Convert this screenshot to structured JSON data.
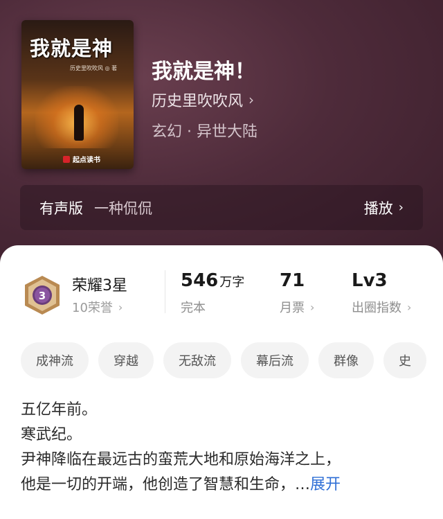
{
  "cover": {
    "title": "我就是神",
    "author": "历史里吹吹风 ◎ 著",
    "publisher": "起点读书"
  },
  "book": {
    "title": "我就是神！",
    "author": "历史里吹吹风",
    "genre": "玄幻 · 异世大陆"
  },
  "audio": {
    "label": "有声版",
    "narrator": "一种侃侃",
    "play_label": "播放"
  },
  "honor": {
    "badge_number": "3",
    "title": "荣耀3星",
    "subtitle": "10荣誉"
  },
  "stats": [
    {
      "value": "546",
      "unit": "万字",
      "label": "完本"
    },
    {
      "value": "71",
      "unit": "",
      "label": "月票"
    },
    {
      "value": "Lv3",
      "unit": "",
      "label": "出圈指数"
    }
  ],
  "tags": [
    "成神流",
    "穿越",
    "无敌流",
    "幕后流",
    "群像",
    "史"
  ],
  "synopsis": {
    "lines": [
      "五亿年前。",
      "寒武纪。",
      "尹神降临在最远古的蛮荒大地和原始海洋之上，",
      "他是一切的开端，他创造了智慧和生命，…"
    ],
    "expand_label": "展开"
  },
  "colors": {
    "hero_bg": "#4e2b3a",
    "link": "#2f6fd6",
    "badge": "#6a3d7a"
  }
}
